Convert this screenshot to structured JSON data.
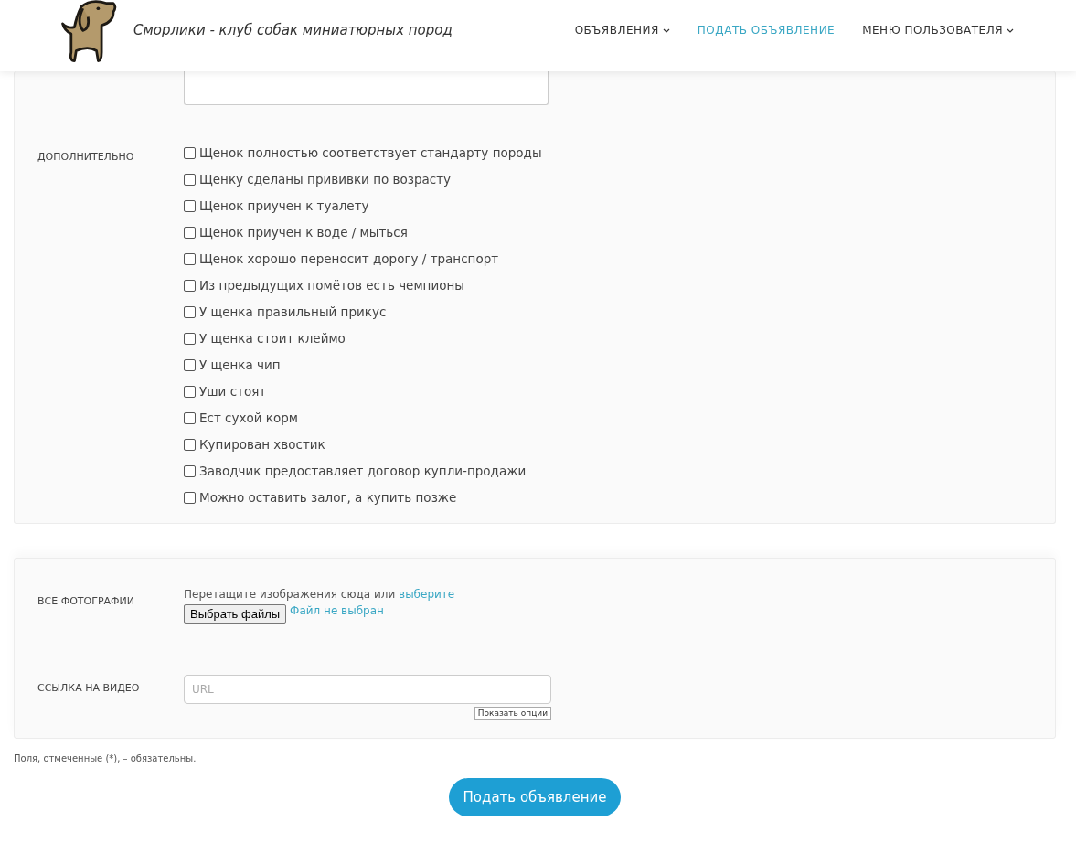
{
  "header": {
    "site_title": "Сморлики - клуб собак миниатюрных пород",
    "nav": [
      {
        "label": "ОБЪЯВЛЕНИЯ",
        "selected": false,
        "has_dropdown": true
      },
      {
        "label": "ПОДАТЬ ОБЪЯВЛЕНИЕ",
        "selected": true,
        "has_dropdown": false
      },
      {
        "label": "МЕНЮ ПОЛЬЗОВАТЕЛЯ",
        "selected": false,
        "has_dropdown": true
      }
    ]
  },
  "extras": {
    "label": "ДОПОЛНИТЕЛЬНО",
    "options": [
      {
        "label": "Щенок полностью соответствует стандарту породы",
        "checked": false
      },
      {
        "label": "Щенку сделаны прививки по возрасту",
        "checked": false
      },
      {
        "label": "Щенок приучен к туалету",
        "checked": false
      },
      {
        "label": "Щенок приучен к воде / мыться",
        "checked": false
      },
      {
        "label": "Щенок хорошо переносит дорогу / транспорт",
        "checked": false
      },
      {
        "label": "Из предыдущих помётов есть чемпионы",
        "checked": false
      },
      {
        "label": "У щенка правильный прикус",
        "checked": false
      },
      {
        "label": "У щенка стоит клеймо",
        "checked": false
      },
      {
        "label": "У щенка чип",
        "checked": false
      },
      {
        "label": "Уши стоят",
        "checked": false
      },
      {
        "label": "Ест сухой корм",
        "checked": false
      },
      {
        "label": "Купирован хвостик",
        "checked": false
      },
      {
        "label": "Заводчик предоставляет договор купли-продажи",
        "checked": false
      },
      {
        "label": "Можно оставить залог, а купить позже",
        "checked": false
      }
    ]
  },
  "photos": {
    "label": "ВСЕ ФОТОГРАФИИ",
    "hint": "Перетащите изображения сюда или",
    "hint_link": "выберите",
    "file_button": "Выбрать файлы",
    "file_status": "Файл не выбран"
  },
  "video": {
    "label": "ССЫЛКА НА ВИДЕО",
    "placeholder": "URL",
    "options_button": "Показать опции"
  },
  "required_note": "Поля, отмеченные (*), – обязательны.",
  "submit": "Подать объявление"
}
